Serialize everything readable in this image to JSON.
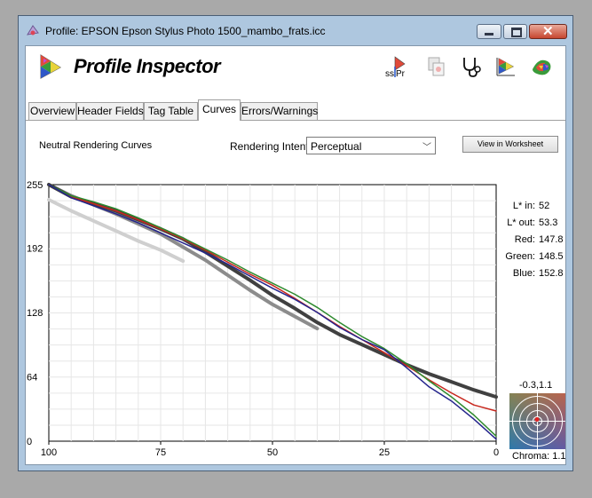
{
  "window": {
    "title": "Profile: EPSON Epson Stylus Photo 1500_mambo_frats.icc"
  },
  "app": {
    "title": "Profile Inspector"
  },
  "toolbar": {
    "icons": [
      "color-profile-tool-icon",
      "copy-profile-icon",
      "stethoscope-icon",
      "gamut-plot-icon",
      "color-gamut-icon"
    ]
  },
  "tabs": [
    {
      "label": "Overview",
      "active": false
    },
    {
      "label": "Header Fields",
      "active": false
    },
    {
      "label": "Tag Table",
      "active": false
    },
    {
      "label": "Curves",
      "active": true
    },
    {
      "label": "Errors/Warnings",
      "active": false
    }
  ],
  "curves": {
    "section_label": "Neutral Rendering Curves",
    "intent_label": "Rendering Intent:",
    "intent_value": "Perceptual",
    "worksheet_button": "View in Worksheet"
  },
  "readout": {
    "l_in_label": "L* in:",
    "l_in": "52",
    "l_out_label": "L* out:",
    "l_out": "53.3",
    "red_label": "Red:",
    "red": "147.8",
    "green_label": "Green:",
    "green": "148.5",
    "blue_label": "Blue:",
    "blue": "152.8"
  },
  "chroma": {
    "coord": "-0.3,1.1",
    "label": "Chroma:",
    "value": "1.1"
  },
  "chart_data": {
    "type": "line",
    "x_ticks": [
      "100",
      "75",
      "50",
      "25",
      "0"
    ],
    "y_ticks": [
      "255",
      "192",
      "128",
      "64",
      "0"
    ],
    "xlim": [
      100,
      0
    ],
    "ylim": [
      0,
      255
    ],
    "grid": true,
    "colors": {
      "red": "#c8281e",
      "green": "#2e8a2e",
      "blue": "#24248c",
      "black": "#404040",
      "gray": "#8c8c8c",
      "lightgray": "#cfcfcf"
    },
    "series": [
      {
        "color": "red",
        "x": [
          100,
          95,
          90,
          85,
          80,
          75,
          70,
          65,
          60,
          55,
          50,
          45,
          40,
          35,
          30,
          25,
          20,
          15,
          10,
          5,
          0
        ],
        "y": [
          255,
          243,
          236,
          229,
          220,
          211,
          201,
          190,
          178,
          166,
          155,
          142,
          128,
          114,
          101,
          88,
          75,
          61,
          48,
          36,
          30
        ]
      },
      {
        "color": "green",
        "x": [
          100,
          95,
          90,
          85,
          80,
          75,
          70,
          65,
          60,
          55,
          50,
          45,
          40,
          35,
          30,
          25,
          20,
          15,
          10,
          5,
          0
        ],
        "y": [
          255,
          244,
          238,
          231,
          222,
          212,
          202,
          191,
          180,
          168,
          157,
          146,
          133,
          118,
          104,
          92,
          77,
          60,
          44,
          26,
          5
        ]
      },
      {
        "color": "blue",
        "x": [
          100,
          95,
          90,
          85,
          80,
          75,
          70,
          65,
          60,
          55,
          50,
          45,
          40,
          35,
          30,
          25,
          20,
          15,
          10,
          5,
          0
        ],
        "y": [
          255,
          242,
          234,
          226,
          217,
          207,
          197,
          187,
          176,
          164,
          152,
          141,
          128,
          113,
          101,
          91,
          73,
          54,
          40,
          22,
          2
        ]
      },
      {
        "color": "black",
        "x": [
          100,
          95,
          90,
          85,
          80,
          75,
          70,
          65,
          60,
          55,
          50,
          45,
          40,
          35,
          30,
          25,
          20,
          15,
          10,
          5,
          0
        ],
        "y": [
          255,
          243,
          236,
          229,
          220,
          211,
          201,
          188,
          174,
          160,
          145,
          132,
          118,
          106,
          96,
          86,
          76,
          67,
          59,
          51,
          44
        ]
      },
      {
        "color": "gray",
        "x": [
          100,
          95,
          90,
          85,
          80,
          75,
          70,
          65,
          60,
          55,
          50,
          45,
          40
        ],
        "y": [
          255,
          244,
          235,
          226,
          216,
          206,
          193,
          180,
          165,
          150,
          136,
          124,
          112
        ]
      },
      {
        "color": "lightgray",
        "x": [
          100,
          95,
          90,
          85,
          80,
          75,
          70
        ],
        "y": [
          240,
          229,
          219,
          209,
          199,
          190,
          179
        ]
      }
    ]
  }
}
